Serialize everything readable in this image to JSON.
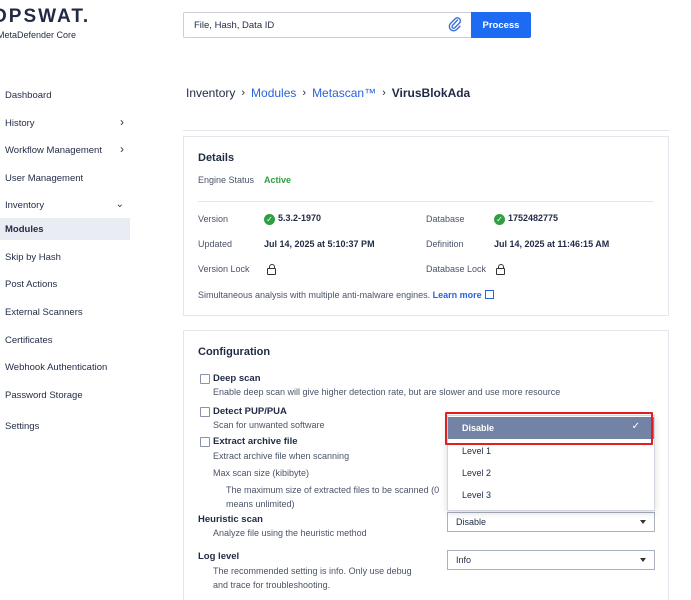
{
  "brand": {
    "logo": "OPSWAT.",
    "product": "MetaDefender Core"
  },
  "sidebar": {
    "items": [
      {
        "label": "Dashboard",
        "chevron": ""
      },
      {
        "label": "History",
        "chevron": "right"
      },
      {
        "label": "Workflow Management",
        "chevron": "right"
      },
      {
        "label": "User Management",
        "chevron": ""
      },
      {
        "label": "Inventory",
        "chevron": "down"
      },
      {
        "label": "Modules",
        "chevron": "",
        "active": true
      },
      {
        "label": "Skip by Hash",
        "chevron": ""
      },
      {
        "label": "Post Actions",
        "chevron": ""
      },
      {
        "label": "External Scanners",
        "chevron": ""
      },
      {
        "label": "Certificates",
        "chevron": ""
      },
      {
        "label": "Webhook Authentication",
        "chevron": ""
      },
      {
        "label": "Password Storage",
        "chevron": ""
      },
      {
        "label": "Settings",
        "chevron": ""
      }
    ]
  },
  "search": {
    "placeholder": "File, Hash, Data ID",
    "button": "Process"
  },
  "breadcrumb": {
    "items": [
      "Inventory",
      "Modules",
      "Metascan™"
    ],
    "current": "VirusBlokAda"
  },
  "details": {
    "title": "Details",
    "engine_status_label": "Engine Status",
    "engine_status_value": "Active",
    "version_label": "Version",
    "version_value": "5.3.2-1970",
    "database_label": "Database",
    "database_value": "1752482775",
    "updated_label": "Updated",
    "updated_value": "Jul 14, 2025 at 5:10:37 PM",
    "definition_label": "Definition",
    "definition_value": "Jul 14, 2025 at 11:46:15 AM",
    "version_lock_label": "Version Lock",
    "database_lock_label": "Database Lock",
    "note": "Simultaneous analysis with multiple anti-malware engines.",
    "learn_more": "Learn more"
  },
  "configuration": {
    "title": "Configuration",
    "deep_scan": {
      "title": "Deep scan",
      "desc": "Enable deep scan will give higher detection rate, but are slower and use more resource"
    },
    "pup": {
      "title": "Detect PUP/PUA",
      "desc": "Scan for unwanted software"
    },
    "archive": {
      "title": "Extract archive file",
      "desc": "Extract archive file when scanning"
    },
    "max_size": {
      "title": "Max scan size (kibibyte)",
      "desc_line1": "The maximum size of extracted files to be scanned (0",
      "desc_line2": "means unlimited)"
    },
    "heuristic": {
      "title": "Heuristic scan",
      "desc": "Analyze file using the heuristic method",
      "value": "Disable"
    },
    "log_level": {
      "title": "Log level",
      "desc_line1": "The recommended setting is info. Only use debug",
      "desc_line2": "and trace for troubleshooting.",
      "value": "Info"
    }
  },
  "dropdown": {
    "options": [
      "Disable",
      "Level 1",
      "Level 2",
      "Level 3"
    ],
    "selected": "Disable"
  },
  "colors": {
    "accent": "#1d6bf3",
    "active": "#2ea043",
    "highlight": "#e02020",
    "selected_bg": "#7383a6"
  }
}
